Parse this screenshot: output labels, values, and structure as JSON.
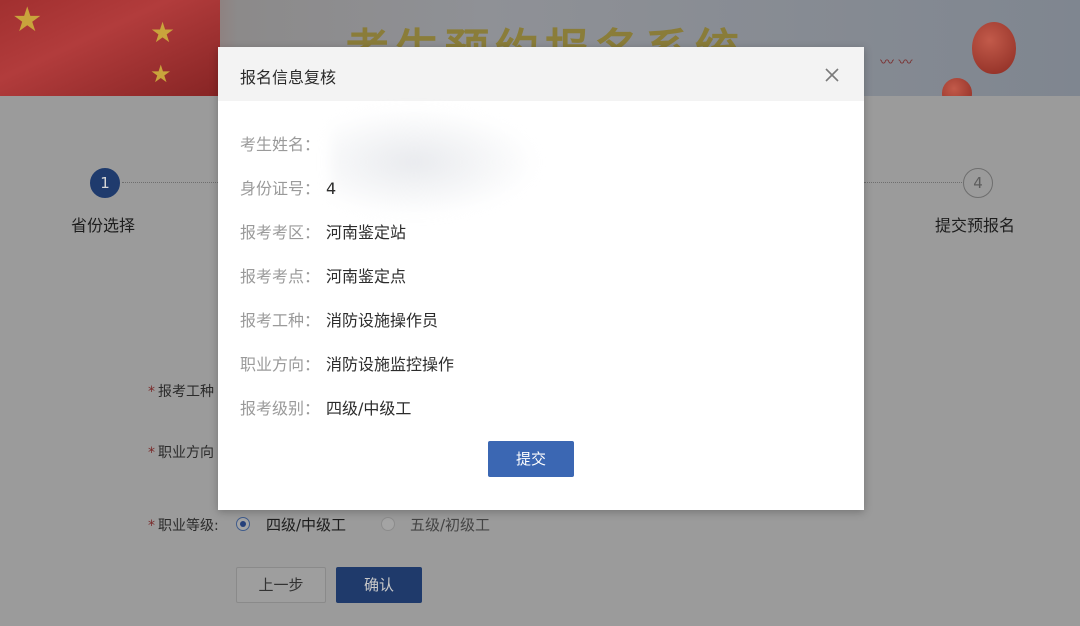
{
  "banner": {
    "title": "考生预约报名系统"
  },
  "steps": [
    {
      "number": "1",
      "label": "省份选择",
      "state": "active"
    },
    {
      "number": "4",
      "label": "提交预报名",
      "state": "todo"
    }
  ],
  "form": {
    "required_mark": "*",
    "exam_type_label": "报考工种",
    "direction_label": "职业方向",
    "level_label": "职业等级:",
    "level_options": [
      {
        "label": "四级/中级工",
        "selected": true
      },
      {
        "label": "五级/初级工",
        "selected": false
      }
    ],
    "prev_button": "上一步",
    "confirm_button": "确认"
  },
  "modal": {
    "title": "报名信息复核",
    "close_icon": "close-icon",
    "rows": [
      {
        "key": "考生姓名：",
        "value": ""
      },
      {
        "key": "身份证号：",
        "value": "4"
      },
      {
        "key": "报考考区：",
        "value": "河南鉴定站"
      },
      {
        "key": "报考考点：",
        "value": "河南鉴定点"
      },
      {
        "key": "报考工种：",
        "value": "消防设施操作员"
      },
      {
        "key": "职业方向：",
        "value": "消防设施监控操作"
      },
      {
        "key": "报考级别：",
        "value": "四级/中级工"
      }
    ],
    "submit_button": "提交"
  },
  "colors": {
    "overlay_bg": "#9b9b9b",
    "primary_blue": "#3b67b3",
    "step_active": "#1f3b6d"
  }
}
